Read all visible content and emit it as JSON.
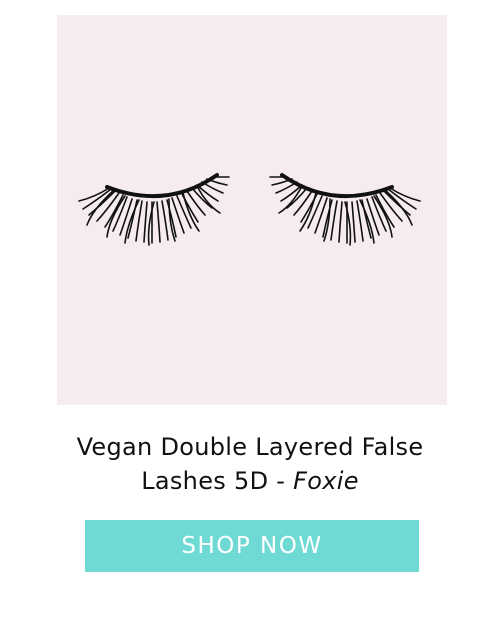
{
  "product": {
    "title_line1": "Vegan Double Layered False",
    "title_line2_prefix": "Lashes 5D - ",
    "title_variant": "Foxie",
    "image_icon": "false-lashes-photo",
    "image_background": "#f6ecef"
  },
  "cta": {
    "label": "SHOP NOW",
    "color": "#6fdad3",
    "text_color": "#ffffff"
  }
}
